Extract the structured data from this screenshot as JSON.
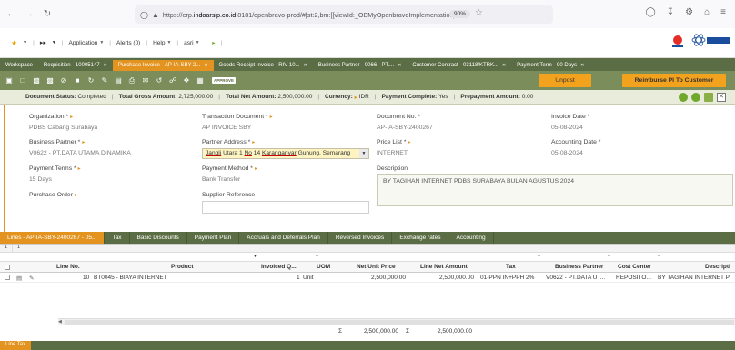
{
  "browser": {
    "url_prefix": "https://erp.",
    "url_domain": "indoarsip.co.id",
    "url_suffix": ":8181/openbravo-prod/#[st:2,bm:[[viewId:_OBMyOpenbravoImplementation_...",
    "zoom": "90%"
  },
  "menu": {
    "application": "Application",
    "alerts": "Alerts (0)",
    "help": "Help",
    "user": "asri"
  },
  "window_tabs": [
    {
      "label": "Workspace"
    },
    {
      "label": "Requisition - 10005147"
    },
    {
      "label": "Purchase Invoice - AP-IA-SBY-2..."
    },
    {
      "label": "Goods Receipt Invoice - RIV-10..."
    },
    {
      "label": "Business Partner - 0066 - PT...."
    },
    {
      "label": "Customer Contract - 03118/KTRK..."
    },
    {
      "label": "Payment Term - 90 Days"
    }
  ],
  "toolbar": {
    "approve_badge": "APPROVE",
    "unpost_label": "Unpost",
    "reimburse_label": "Reimburse PI To Customer"
  },
  "status": {
    "document_status_label": "Document Status:",
    "document_status": "Completed",
    "total_gross_label": "Total Gross Amount:",
    "total_gross": "2,725,000.00",
    "total_net_label": "Total Net Amount:",
    "total_net": "2,500,000.00",
    "currency_label": "Currency:",
    "currency": "IDR",
    "payment_complete_label": "Payment Complete:",
    "payment_complete": "Yes",
    "prepayment_label": "Prepayment Amount:",
    "prepayment": "0.00"
  },
  "form": {
    "organization_label": "Organization",
    "organization": "PDBS Cabang Surabaya",
    "transaction_doc_label": "Transaction Document",
    "transaction_doc": "AP INVOICE SBY",
    "document_no_label": "Document No.",
    "document_no": "AP-IA-SBY-2400267",
    "invoice_date_label": "Invoice Date",
    "invoice_date": "05-08-2024",
    "business_partner_label": "Business Partner",
    "business_partner": "V0622 - PT.DATA UTAMA DINAMIKA",
    "partner_address_label": "Partner Address",
    "partner_address_a": "Jangli",
    "partner_address_b": " Utara 1 ",
    "partner_address_c": "No",
    "partner_address_d": " 14 ",
    "partner_address_e": "Karanganyar",
    "partner_address_f": " Gunung, Semarang",
    "price_list_label": "Price List",
    "price_list": "INTERNET",
    "accounting_date_label": "Accounting Date",
    "accounting_date": "05-08-2024",
    "payment_terms_label": "Payment Terms",
    "payment_terms": "15 Days",
    "payment_method_label": "Payment Method",
    "payment_method": "Bank Transfer",
    "description_label": "Description",
    "description": "BY TAGIHAN INTERNET PDBS SURABAYA BULAN AGUSTUS 2024",
    "purchase_order_label": "Purchase Order",
    "supplier_reference_label": "Supplier Reference"
  },
  "lines_tabs": [
    {
      "label": "Lines - AP-IA-SBY-2400267 - 05..."
    },
    {
      "label": "Tax"
    },
    {
      "label": "Basic Discounts"
    },
    {
      "label": "Payment Plan"
    },
    {
      "label": "Accruals and Deferrals Plan"
    },
    {
      "label": "Reversed Invoices"
    },
    {
      "label": "Exchange rates"
    },
    {
      "label": "Accounting"
    }
  ],
  "grid": {
    "page_cols": [
      "1",
      "1"
    ],
    "headers": {
      "line_no": "Line No.",
      "product": "Product",
      "invoiced_qty": "Invoiced Q...",
      "uom": "UOM",
      "net_unit_price": "Net Unit Price",
      "line_net_amount": "Line Net Amount",
      "tax": "Tax",
      "business_partner": "Business Partner",
      "cost_center": "Cost Center",
      "description": "Descripti"
    },
    "rows": [
      {
        "line_no": "10",
        "product": "BT0045 - BIAYA INTERNET",
        "invoiced_qty": "1",
        "uom": "Unit",
        "net_unit_price": "2,500,000.00",
        "line_net_amount": "2,500,000.00",
        "tax": "01-PPN IN+PPH 2%",
        "business_partner": "V0622 - PT.DATA UT...",
        "cost_center": "REPOSITO...",
        "description": "BY TAGIHAN INTERNET P"
      }
    ],
    "sum_symbol": "Σ",
    "sum_net_unit_price": "2,500,000.00",
    "sum_line_net_amount": "2,500,000.00"
  },
  "bottom_tab": "Line Tax",
  "colors": {
    "accent_orange": "#e3931f",
    "olive_dark": "#5b6d44",
    "olive_toolbar": "#7a8d5b",
    "status_bg": "#e9ecdb"
  }
}
